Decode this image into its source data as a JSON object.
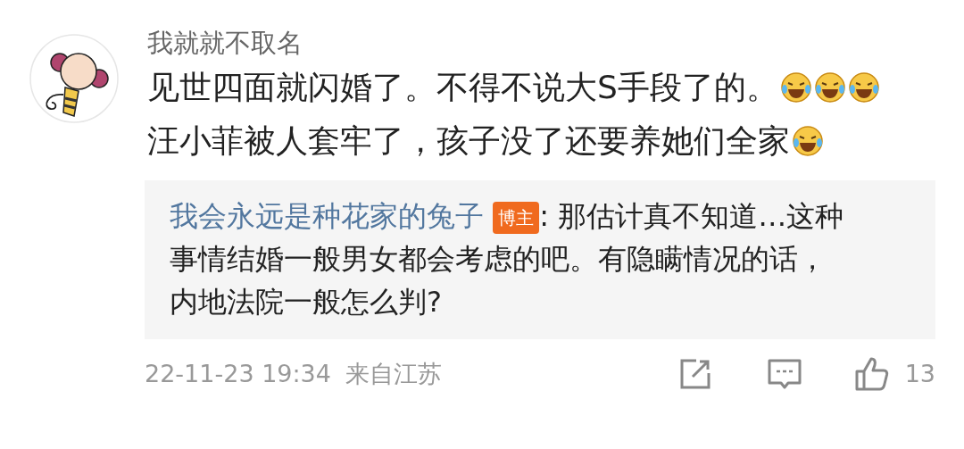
{
  "comment": {
    "author": "我就就不取名",
    "lines": [
      [
        {
          "kind": "text",
          "text": "见世四面就闪婚了。不得不说大S手段了的。"
        },
        {
          "kind": "emoji"
        },
        {
          "kind": "emoji"
        },
        {
          "kind": "emoji"
        }
      ],
      [
        {
          "kind": "text",
          "text": "汪小菲被人套牢了，孩子没了还要养她们全家"
        },
        {
          "kind": "emoji"
        }
      ]
    ]
  },
  "reply": {
    "author": "我会永远是种花家的兔子",
    "badge": "博主",
    "text": ": 那估计真不知道…这种事情结婚一般男女都会考虑的吧。有隐瞒情况的话，内地法院一般怎么判?"
  },
  "footer": {
    "time": "22-11-23 19:34",
    "location": "来自江苏",
    "likes": "13"
  }
}
